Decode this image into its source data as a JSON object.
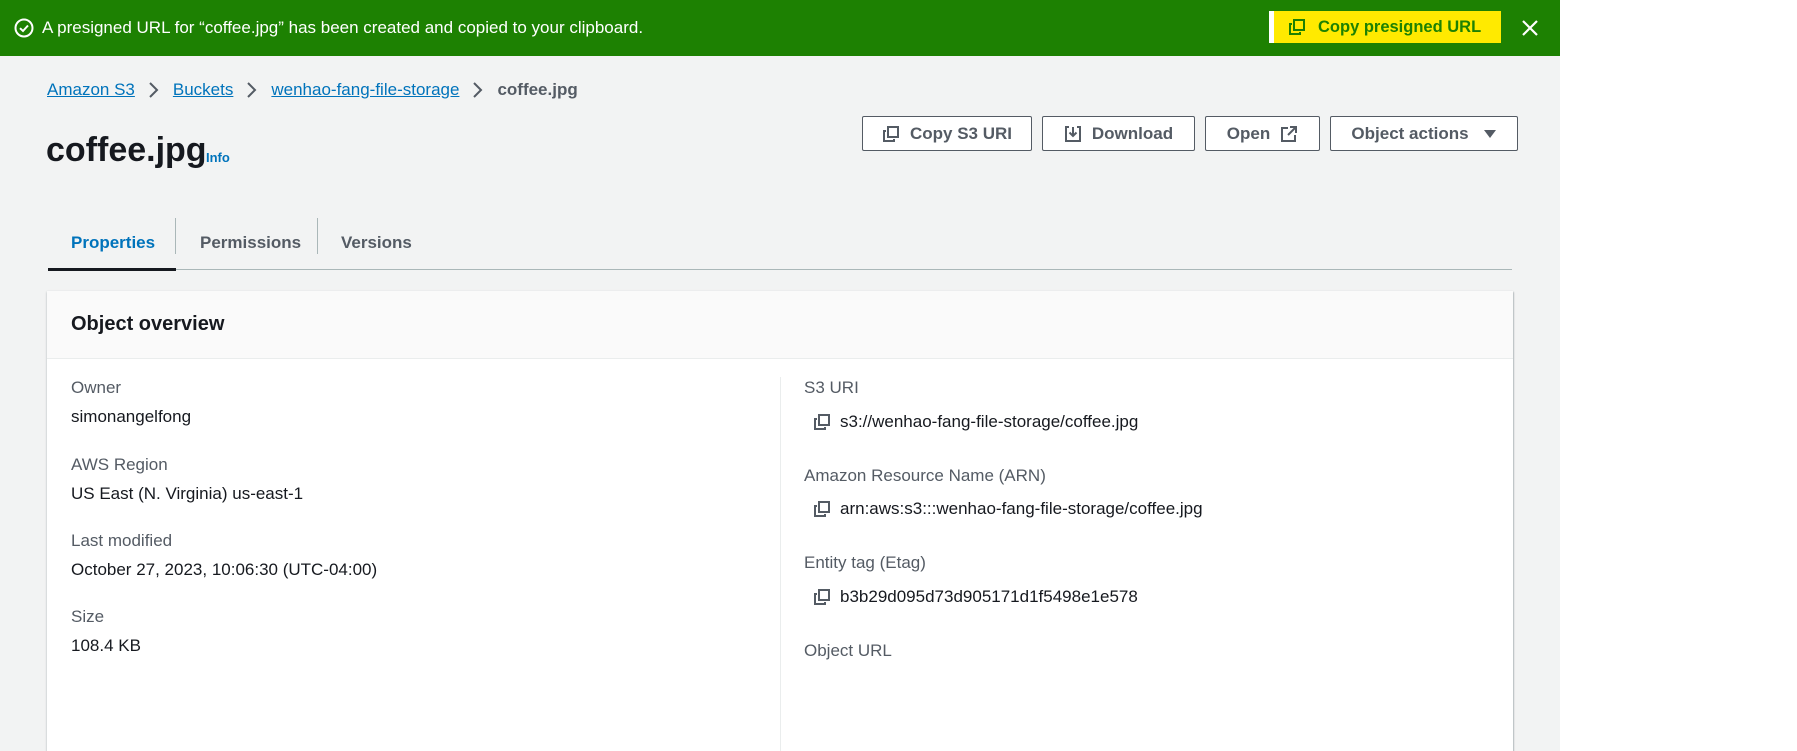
{
  "flash": {
    "message": "A presigned URL for “coffee.jpg” has been created and copied to your clipboard.",
    "copy_button": "Copy presigned URL"
  },
  "breadcrumb": {
    "items": [
      "Amazon S3",
      "Buckets",
      "wenhao-fang-file-storage"
    ],
    "current": "coffee.jpg"
  },
  "header": {
    "title": "coffee.jpg",
    "info": "Info"
  },
  "actions": {
    "copy_s3_uri": "Copy S3 URI",
    "download": "Download",
    "open": "Open",
    "object_actions": "Object actions"
  },
  "tabs": [
    {
      "label": "Properties",
      "active": true
    },
    {
      "label": "Permissions",
      "active": false
    },
    {
      "label": "Versions",
      "active": false
    }
  ],
  "overview": {
    "title": "Object overview",
    "left": [
      {
        "label": "Owner",
        "value": "simonangelfong"
      },
      {
        "label": "AWS Region",
        "value": "US East (N. Virginia) us-east-1"
      },
      {
        "label": "Last modified",
        "value": "October 27, 2023, 10:06:30 (UTC-04:00)"
      },
      {
        "label": "Size",
        "value": "108.4 KB"
      }
    ],
    "right": [
      {
        "label": "S3 URI",
        "value": "s3://wenhao-fang-file-storage/coffee.jpg"
      },
      {
        "label": "Amazon Resource Name (ARN)",
        "value": "arn:aws:s3:::wenhao-fang-file-storage/coffee.jpg"
      },
      {
        "label": "Entity tag (Etag)",
        "value": "b3b29d095d73d905171d1f5498e1e578"
      },
      {
        "label": "Object URL",
        "value": ""
      }
    ]
  },
  "colors": {
    "flash_bg": "#1d8102",
    "highlight": "#ffea00",
    "link": "#0073bb"
  }
}
